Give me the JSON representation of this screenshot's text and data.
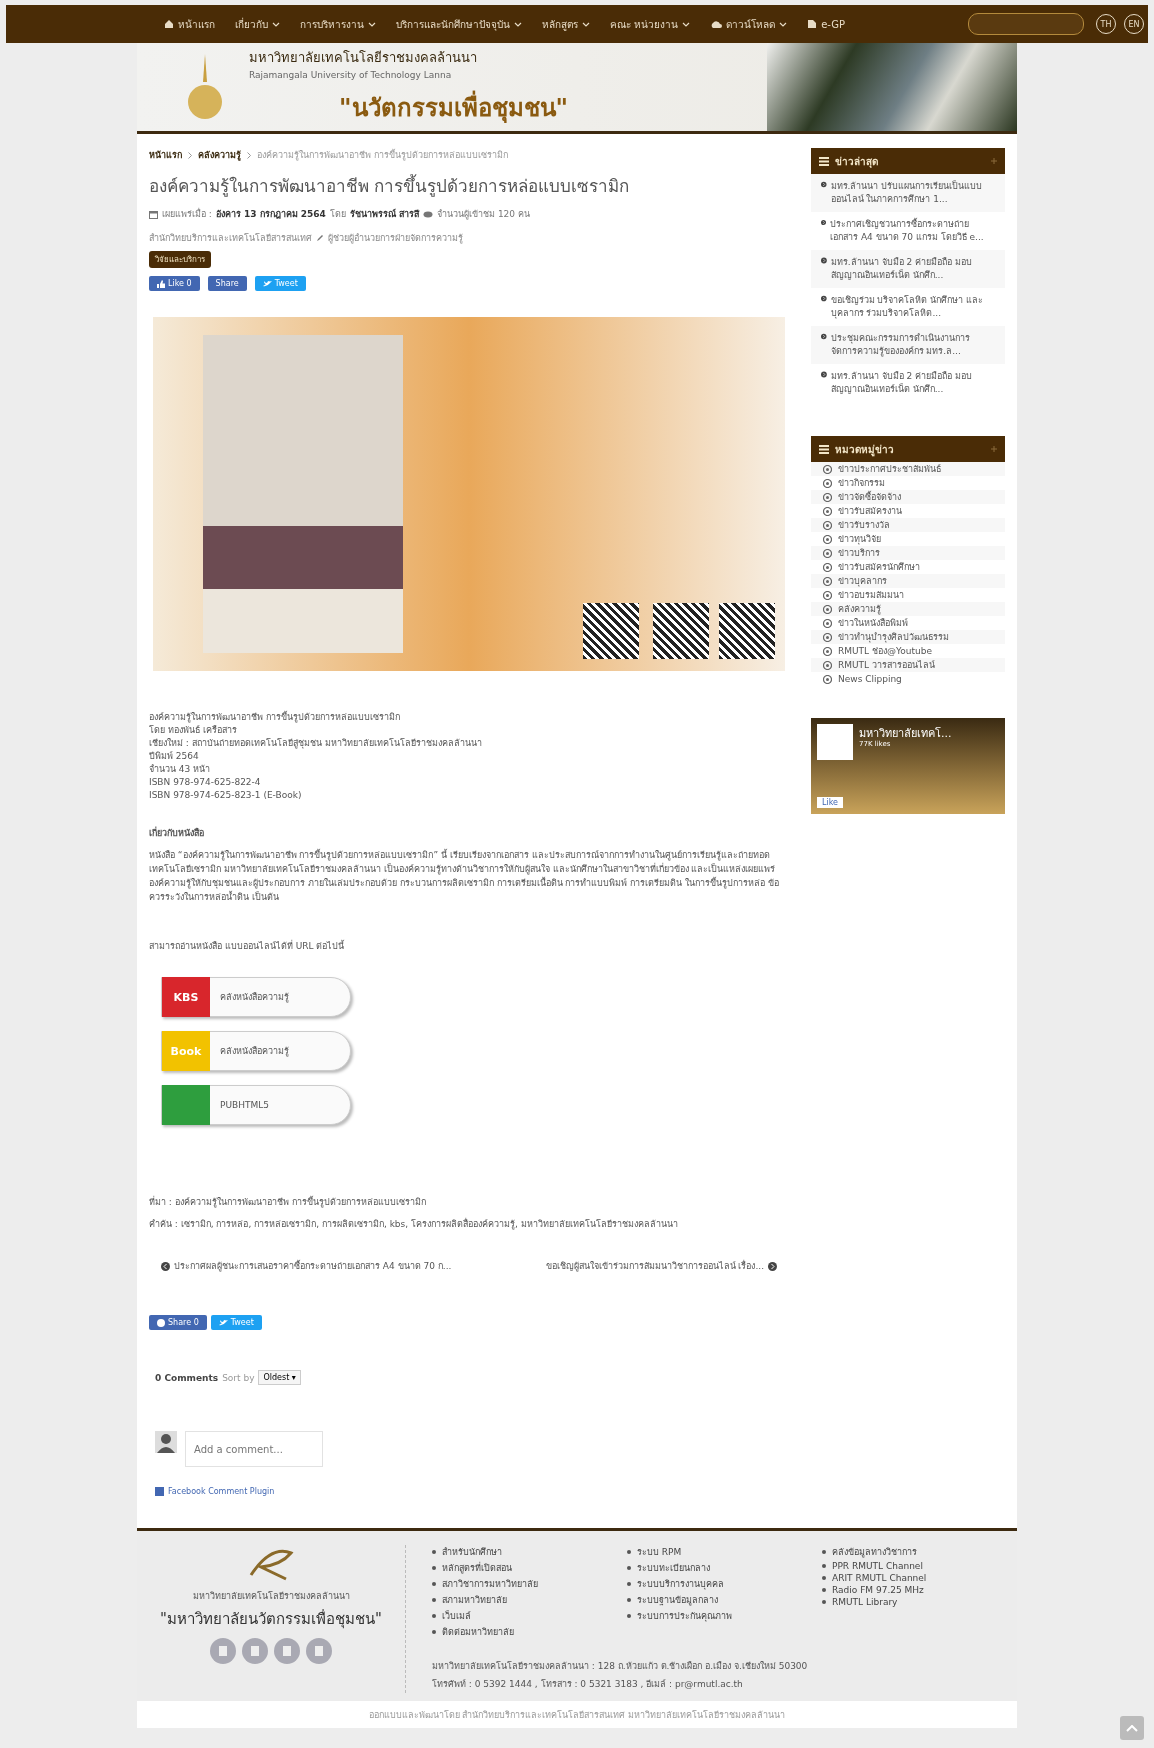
{
  "nav": {
    "items": [
      {
        "label": "หน้าแรก",
        "kind": "home"
      },
      {
        "label": "เกี่ยวกับ",
        "kind": "dropdown"
      },
      {
        "label": "การบริหารงาน",
        "kind": "dropdown"
      },
      {
        "label": "บริการและนักศึกษาปัจจุบัน",
        "kind": "dropdown"
      },
      {
        "label": "หลักสูตร",
        "kind": "dropdown"
      },
      {
        "label": "คณะ หน่วยงาน",
        "kind": "dropdown"
      },
      {
        "label": "ดาวน์โหลด",
        "kind": "cloud-dropdown"
      },
      {
        "label": "e-GP",
        "kind": "doc"
      }
    ],
    "languages": [
      "TH",
      "EN"
    ]
  },
  "header": {
    "name_th": "มหาวิทยาลัยเทคโนโลยีราชมงคลล้านนา",
    "name_en": "Rajamangala University of Technology Lanna",
    "slogan": "\"นวัตกรรมเพื่อชุมชน\""
  },
  "breadcrumb": [
    "หน้าแรก",
    "คลังความรู้",
    "องค์ความรู้ในการพัฒนาอาชีพ การขึ้นรูปด้วยการหล่อแบบเซรามิก"
  ],
  "article": {
    "title": "องค์ความรู้ในการพัฒนาอาชีพ การขึ้นรูปด้วยการหล่อแบบเซรามิก",
    "published_label": "เผยแพร่เมื่อ :",
    "date": "อังคาร 13 กรกฎาคม 2564",
    "by_label": "โดย",
    "author": "รัชนาพรรณ์ สารสี",
    "views": "จำนวนผู้เข้าชม 120 คน",
    "department": "สำนักวิทยบริการและเทคโนโลยีสารสนเทศ",
    "position": "ผู้ช่วยผู้อำนวยการฝ่ายจัดการความรู้",
    "badge": "วิจัยและบริการ",
    "social_top": [
      {
        "label": "Like 0",
        "kind": "like"
      },
      {
        "label": "Share",
        "kind": "share"
      },
      {
        "label": "Tweet",
        "kind": "tweet"
      }
    ],
    "book_info": [
      "องค์ความรู้ในการพัฒนาอาชีพ การขึ้นรูปด้วยการหล่อแบบเซรามิก",
      "โดย ทองพันธ์ เครือสาร",
      "เชียงใหม่ : สถาบันถ่ายทอดเทคโนโลยีสู่ชุมชน มหาวิทยาลัยเทคโนโลยีราชมงคลล้านนา",
      "ปีพิมพ์ 2564",
      "จำนวน 43 หน้า",
      "ISBN 978-974-625-822-4",
      "ISBN 978-974-625-823-1 (E-Book)"
    ],
    "about_heading": "เกี่ยวกับหนังสือ",
    "about": "หนังสือ “องค์ความรู้ในการพัฒนาอาชีพ การขึ้นรูปด้วยการหล่อแบบเซรามิก” นี้ เรียบเรียงจากเอกสาร และประสบการณ์จากการทำงานในศูนย์การเรียนรู้และถ่ายทอดเทคโนโลยีเซรามิก มหาวิทยาลัยเทคโนโลยีราชมงคลล้านนา เป็นองค์ความรู้ทางด้านวิชาการให้กับผู้สนใจ และนักศึกษาในสาขาวิชาที่เกี่ยวข้อง และเป็นแหล่งเผยแพร่องค์ความรู้ให้กับชุมชนและผู้ประกอบการ ภายในเล่มประกอบด้วย กระบวนการผลิตเซรามิก การเตรียมเนื้อดิน การทำแบบพิมพ์ การเตรียมดิน ในการขึ้นรูปการหล่อ ข้อควรระวังในการหล่อน้ำดิน เป็นต้น",
    "read_online": "สามารถอ่านหนังสือ แบบออนไลน์ได้ที่ URL ต่อไปนี้",
    "ebook_links": [
      {
        "logo": "KBS",
        "label": "คลังหนังสือความรู้",
        "color": "#d8262c"
      },
      {
        "logo": "Book",
        "label": "คลังหนังสือความรู้",
        "color": "#f2c200"
      },
      {
        "label": "PUBHTML5",
        "color": "#2e9e3e"
      }
    ],
    "source": "ที่มา : องค์ความรู้ในการพัฒนาอาชีพ การขึ้นรูปด้วยการหล่อแบบเซรามิก",
    "keywords": "คำค้น : เซรามิก, การหล่อ, การหล่อเซรามิก, การผลิตเซรามิก, kbs, โครงการผลิตสื่อองค์ความรู้, มหาวิทยาลัยเทคโนโลยีราชมงคลล้านนา",
    "prev": "ประกาศผลผู้ชนะการเสนอราคาซื้อกระดาษถ่ายเอกสาร A4 ขนาด 70 ก...",
    "next": "ขอเชิญผู้สนใจเข้าร่วมการสัมมนาวิชาการออนไลน์ เรื่อง...",
    "social_bottom": [
      {
        "label": "Share 0",
        "kind": "share"
      },
      {
        "label": "Tweet",
        "kind": "tweet"
      }
    ]
  },
  "comments": {
    "count": "0 Comments",
    "sort_label": "Sort by",
    "sort": "Oldest ▾",
    "placeholder": "Add a comment...",
    "plugin": "Facebook Comment Plugin"
  },
  "sidebar": {
    "latest_title": "ข่าวล่าสุด",
    "latest": [
      "มทร.ล้านนา ปรับแผนการเรียนเป็นแบบออนไลน์ ในภาคการศึกษา 1...",
      "ประกาศเชิญชวนการซื้อกระดาษถ่ายเอกสาร A4 ขนาด 70 แกรม โดยวิธี e...",
      "มทร.ล้านนา จับมือ 2 ค่ายมือถือ มอบสัญญาณอินเทอร์เน็ต นักศึก...",
      "ขอเชิญร่วม บริจาคโลหิต นักศึกษา และบุคลากร ร่วมบริจาคโลหิต...",
      "ประชุมคณะกรรมการดำเนินงานการจัดการความรู้ขององค์กร มทร.ล...",
      "มทร.ล้านนา จับมือ 2 ค่ายมือถือ มอบสัญญาณอินเทอร์เน็ต นักศึก..."
    ],
    "categories_title": "หมวดหมู่ข่าว",
    "categories": [
      "ข่าวประกาศประชาสัมพันธ์",
      "ข่าวกิจกรรม",
      "ข่าวจัดซื้อจัดจ้าง",
      "ข่าวรับสมัครงาน",
      "ข่าวรับรางวัล",
      "ข่าวทุนวิจัย",
      "ข่าวบริการ",
      "ข่าวรับสมัครนักศึกษา",
      "ข่าวบุคลากร",
      "ข่าวอบรมสัมมนา",
      "คลังความรู้",
      "ข่าวในหนังสือพิมพ์",
      "ข่าวทำนุบำรุงศิลปวัฒนธรรม",
      "RMUTL ช่อง@Youtube",
      "RMUTL วารสารออนไลน์",
      "News Clipping"
    ],
    "fb_page": {
      "name": "มหาวิทยาลัยเทคโ...",
      "likes": "77K likes",
      "like_button": "Like"
    }
  },
  "footer": {
    "name": "มหาวิทยาลัยเทคโนโลยีราชมงคลล้านนา",
    "slogan": "\"มหาวิทยาลัยนวัตกรรมเพื่อชุมชน\"",
    "link_columns": [
      [
        "สำหรับนักศึกษา",
        "หลักสูตรที่เปิดสอน",
        "สภาวิชาการมหาวิทยาลัย",
        "สภามหาวิทยาลัย",
        "เว็บเมล์",
        "ติดต่อมหาวิทยาลัย"
      ],
      [
        "ระบบ RPM",
        "ระบบทะเบียนกลาง",
        "ระบบบริการงานบุคคล",
        "ระบบฐานข้อมูลกลาง",
        "ระบบการประกันคุณภาพ"
      ],
      [
        "คลังข้อมูลทางวิชาการ",
        "PPR RMUTL Channel",
        "ARIT RMUTL Channel",
        "Radio FM 97.25 MHz",
        "RMUTL Library"
      ]
    ],
    "address": "มหาวิทยาลัยเทคโนโลยีราชมงคลล้านนา : 128 ถ.ห้วยแก้ว ต.ช้างเผือก อ.เมือง จ.เชียงใหม่ 50300",
    "contact": "โทรศัพท์ : 0 5392 1444 , โทรสาร : 0 5321 3183 , อีเมล์ : pr@rmutl.ac.th",
    "credit": "ออกแบบและพัฒนาโดย สำนักวิทยบริการและเทคโนโลยีสารสนเทศ มหาวิทยาลัยเทคโนโลยีราชมงคลล้านนา"
  }
}
